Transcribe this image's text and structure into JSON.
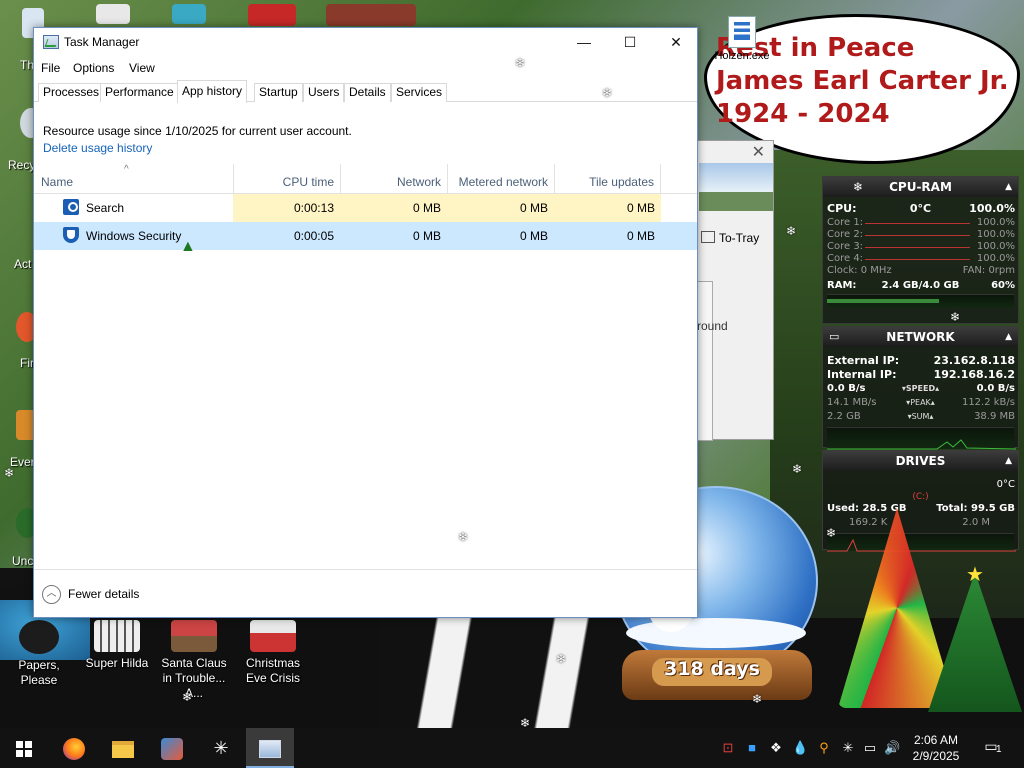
{
  "taskmanager": {
    "title": "Task Manager",
    "window_controls": {
      "minimize": "—",
      "maximize": "☐",
      "close": "✕"
    },
    "menu": [
      "File",
      "Options",
      "View"
    ],
    "tabs": [
      "Processes",
      "Performance",
      "App history",
      "Startup",
      "Users",
      "Details",
      "Services"
    ],
    "active_tab": "App history",
    "usage_text": "Resource usage since 1/10/2025 for current user account.",
    "delete_link": "Delete usage history",
    "columns": [
      "Name",
      "CPU time",
      "Network",
      "Metered network",
      "Tile updates"
    ],
    "sort_indicator": "^",
    "rows": [
      {
        "name": "Search",
        "icon": "search-app-icon",
        "cpu": "0:00:13",
        "network": "0 MB",
        "metered": "0 MB",
        "tile": "0 MB"
      },
      {
        "name": "Windows Security",
        "icon": "shield-icon",
        "cpu": "0:00:05",
        "network": "0 MB",
        "metered": "0 MB",
        "tile": "0 MB"
      }
    ],
    "footer": "Fewer details",
    "accent": "#1764b8",
    "selection_color": "#cce8ff",
    "heat_color": "#fff4c4"
  },
  "desktop": {
    "icons": [
      {
        "label": "Papers, Please",
        "color": "#2a2a2a"
      },
      {
        "label": "Super Hilda",
        "color": "#e4e4e4"
      },
      {
        "label": "Santa Claus in Trouble... A...",
        "color": "#b34a3a"
      },
      {
        "label": "Christmas Eve Crisis",
        "color": "#ddd"
      }
    ],
    "left_partial_labels": [
      "Th",
      "Recy",
      "Act",
      "Fir",
      "Ever",
      "Unc"
    ],
    "holzen_label": "Holzen.exe",
    "rip_lines": [
      "Rest in Peace",
      "James Earl Carter Jr.",
      "1924 - 2024"
    ],
    "bg_window": {
      "to_tray": "To-Tray",
      "round": "round",
      "close": "✕"
    }
  },
  "gadgets": {
    "cpu_ram": {
      "title": "CPU-RAM",
      "cpu_label": "CPU:",
      "cpu_temp": "0°C",
      "cpu_value": "100.0%",
      "cores": [
        {
          "label": "Core 1:",
          "value": "100.0%"
        },
        {
          "label": "Core 2:",
          "value": "100.0%"
        },
        {
          "label": "Core 3:",
          "value": "100.0%"
        },
        {
          "label": "Core 4:",
          "value": "100.0%"
        }
      ],
      "clock": "Clock: 0 MHz",
      "fan": "FAN: 0rpm",
      "ram_label": "RAM:",
      "ram_used": "2.4 GB/4.0 GB",
      "ram_pct": "60%"
    },
    "network": {
      "title": "NETWORK",
      "external_label": "External IP:",
      "external": "23.162.8.118",
      "internal_label": "Internal IP:",
      "internal": "192.168.16.2",
      "speed_left": "0.0 B/s",
      "speed_tag": "SPEED",
      "speed_right": "0.0 B/s",
      "peak_left": "14.1 MB/s",
      "peak_tag": "PEAK",
      "peak_right": "112.2 kB/s",
      "sum_left": "2.2 GB",
      "sum_tag": "SUM",
      "sum_right": "38.9 MB"
    },
    "drives": {
      "title": "DRIVES",
      "temp": "0°C",
      "drive": "(C:)",
      "used": "Used: 28.5 GB",
      "total": "Total: 99.5 GB",
      "read": "169.2 K",
      "write": "2.0 M"
    }
  },
  "globe": {
    "days": "318 days"
  },
  "taskbar": {
    "time": "2:06 AM",
    "date": "2/9/2025",
    "notification_count": "1",
    "items": [
      "start-icon",
      "firefox-icon",
      "file-explorer-icon",
      "app-icon",
      "snowflake-icon",
      "task-manager-icon"
    ]
  }
}
